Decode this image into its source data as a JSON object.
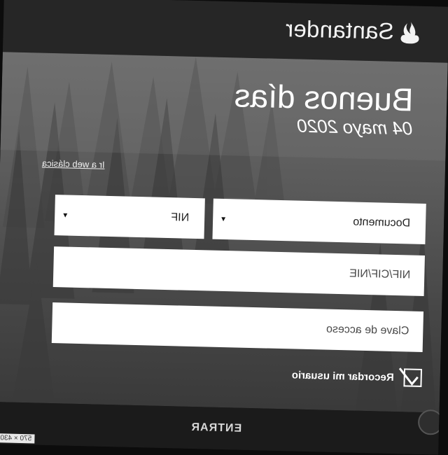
{
  "brand": {
    "name": "Santander",
    "icon": "santander-flame-icon"
  },
  "greeting": {
    "title": "Buenos días",
    "date": "04 mayo 2020"
  },
  "links": {
    "classic_web": "Ir a web clásica"
  },
  "form": {
    "document_select": {
      "label": "Documento"
    },
    "doc_type_select": {
      "value": "NIF"
    },
    "id_field": {
      "placeholder": "NIF/CIF/NIE"
    },
    "password_field": {
      "placeholder": "Clave de acceso"
    },
    "remember": {
      "label": "Recordar mi usuario",
      "checked": true
    }
  },
  "submit": {
    "label": "ENTRAR"
  },
  "viewport_tag": "570 × 430",
  "colors": {
    "background": "#1d1d1d",
    "header": "#262626",
    "field": "#ffffff",
    "text": "#ffffff"
  }
}
